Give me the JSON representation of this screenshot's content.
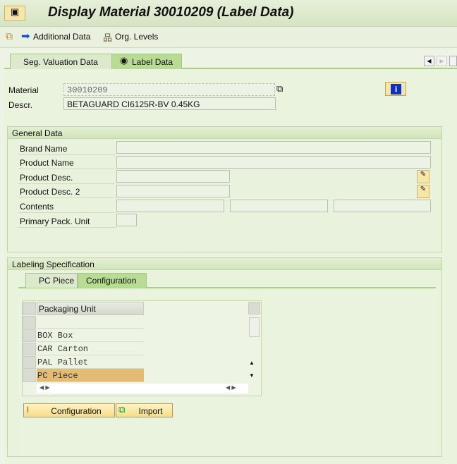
{
  "window": {
    "title": "Display Material 30010209 (Label Data)"
  },
  "toolbar": {
    "additional_data": "Additional Data",
    "org_levels": "Org. Levels"
  },
  "tabs": [
    {
      "label": "Seg. Valuation Data"
    },
    {
      "label": "Label Data",
      "active": true
    }
  ],
  "header": {
    "material_label": "Material",
    "material_value": "30010209",
    "descr_label": "Descr.",
    "descr_value": "BETAGUARD CI6125R-BV 0.45KG"
  },
  "general": {
    "title": "General Data",
    "fields": {
      "brand": "Brand Name",
      "product_name": "Product Name",
      "product_desc": "Product Desc.",
      "product_desc2": "Product Desc. 2",
      "contents": "Contents",
      "primary_pack": "Primary Pack. Unit"
    }
  },
  "labeling": {
    "title": "Labeling Specification",
    "tabs": [
      {
        "label": "PC Piece"
      },
      {
        "label": "Configuration",
        "active": true
      }
    ],
    "table": {
      "header": "Packaging Unit",
      "rows": [
        "",
        "BOX Box",
        "CAR Carton",
        "PAL Pallet",
        "PC Piece"
      ],
      "selected": 4
    },
    "buttons": {
      "configuration": "Configuration",
      "import": "Import"
    }
  }
}
